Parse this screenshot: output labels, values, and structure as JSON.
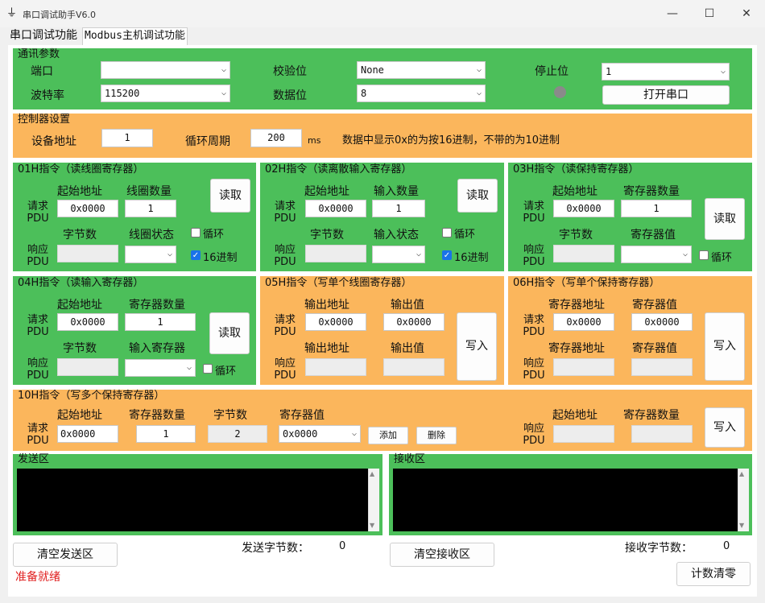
{
  "window": {
    "title": "串口调试助手V6.0",
    "minimize": "—",
    "maximize": "☐",
    "close": "✕"
  },
  "tabs": [
    {
      "label": "串口调试功能"
    },
    {
      "label": "Modbus主机调试功能"
    }
  ],
  "comm": {
    "title": "通讯参数",
    "port_label": "端口",
    "port_value": "",
    "baud_label": "波特率",
    "baud_value": "115200",
    "parity_label": "校验位",
    "parity_value": "None",
    "databits_label": "数据位",
    "databits_value": "8",
    "stopbits_label": "停止位",
    "stopbits_value": "1",
    "open_button": "打开串口",
    "indicator_color": "#8a8a8a"
  },
  "ctrl": {
    "title": "控制器设置",
    "addr_label": "设备地址",
    "addr_value": "1",
    "cycle_label": "循环周期",
    "cycle_value": "200",
    "cycle_unit": "ms",
    "hint": "数据中显示0x的为按16进制，不带的为10进制"
  },
  "common": {
    "req1": "请求",
    "req2": "PDU",
    "resp1": "响应",
    "resp2": "PDU",
    "read": "读取",
    "write": "写入",
    "loop": "循环",
    "hex16": "16进制",
    "bytes": "字节数"
  },
  "f01": {
    "title": "01H指令（读线圈寄存器）",
    "start_label": "起始地址",
    "start_value": "0x0000",
    "count_label": "线圈数量",
    "count_value": "1",
    "status_label": "线圈状态"
  },
  "f02": {
    "title": "02H指令（读离散输入寄存器）",
    "start_label": "起始地址",
    "start_value": "0x0000",
    "count_label": "输入数量",
    "count_value": "1",
    "status_label": "输入状态"
  },
  "f03": {
    "title": "03H指令（读保持寄存器）",
    "start_label": "起始地址",
    "start_value": "0x0000",
    "count_label": "寄存器数量",
    "count_value": "1",
    "value_label": "寄存器值"
  },
  "f04": {
    "title": "04H指令（读输入寄存器）",
    "start_label": "起始地址",
    "start_value": "0x0000",
    "count_label": "寄存器数量",
    "count_value": "1",
    "value_label": "输入寄存器"
  },
  "f05": {
    "title": "05H指令（写单个线圈寄存器）",
    "out_addr_label": "输出地址",
    "out_addr_value": "0x0000",
    "out_val_label": "输出值",
    "out_val_value": "0x0000",
    "resp_addr_label": "输出地址",
    "resp_val_label": "输出值"
  },
  "f06": {
    "title": "06H指令（写单个保持寄存器）",
    "reg_addr_label": "寄存器地址",
    "reg_addr_value": "0x0000",
    "reg_val_label": "寄存器值",
    "reg_val_value": "0x0000",
    "resp_addr_label": "寄存器地址",
    "resp_val_label": "寄存器值"
  },
  "f10": {
    "title": "10H指令（写多个保持寄存器）",
    "start_label": "起始地址",
    "start_value": "0x0000",
    "count_label": "寄存器数量",
    "count_value": "1",
    "bytes_value": "2",
    "value_label": "寄存器值",
    "value_selected": "0x0000",
    "add_button": "添加",
    "delete_button": "删除",
    "resp_start_label": "起始地址",
    "resp_count_label": "寄存器数量"
  },
  "send": {
    "title": "发送区",
    "clear_button": "清空发送区",
    "count_label": "发送字节数：",
    "count_value": "0"
  },
  "recv": {
    "title": "接收区",
    "clear_button": "清空接收区",
    "count_label": "接收字节数：",
    "count_value": "0"
  },
  "reset_counter_button": "计数清零",
  "status_text": "准备就绪"
}
